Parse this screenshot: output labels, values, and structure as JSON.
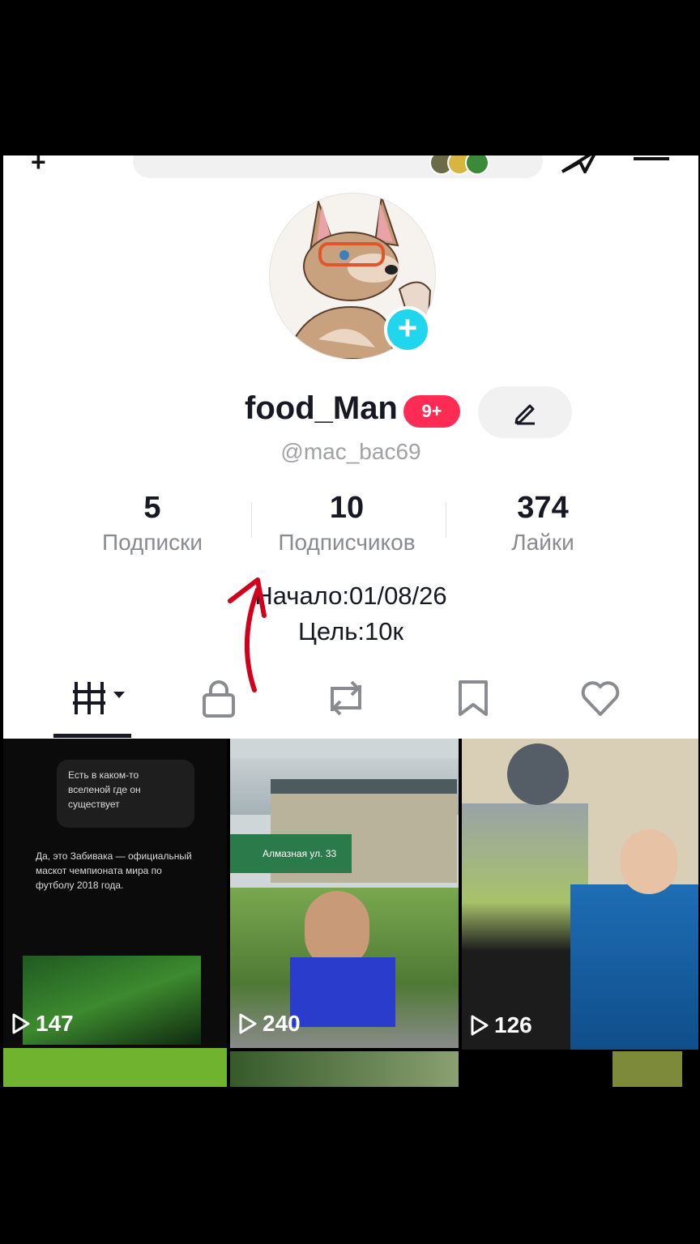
{
  "profile": {
    "name": "food_Man",
    "badge": "9+",
    "handle": "@mac_bac69"
  },
  "stats": [
    {
      "value": "5",
      "label": "Подписки"
    },
    {
      "value": "10",
      "label": "Подписчиков"
    },
    {
      "value": "374",
      "label": "Лайки"
    }
  ],
  "bio": {
    "line1": "Начало:01/08/26",
    "line2": "Цель:10к"
  },
  "tabs": [
    "grid-icon",
    "lock-icon",
    "repost-icon",
    "bookmark-icon",
    "heart-icon"
  ],
  "videos": [
    {
      "views": "147",
      "caption_question": "Есть в каком-то вселеной где он существует",
      "caption_answer": "Да, это Забивака — официальный маскот чемпионата мира по футболу 2018 года."
    },
    {
      "views": "240",
      "sign": "Алмазная ул. 33"
    },
    {
      "views": "126"
    }
  ],
  "colors": {
    "accent": "#fe2c55",
    "add_button": "#20d5ec",
    "annotation_arrow": "#d0021b"
  }
}
